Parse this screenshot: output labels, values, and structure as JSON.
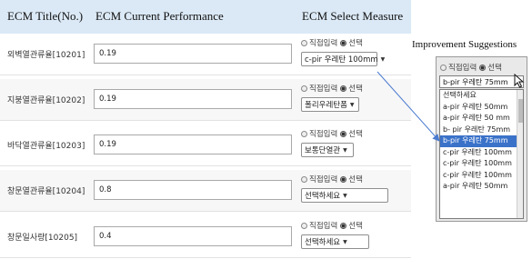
{
  "header": {
    "col_title": "ECM Title(No.)",
    "col_perf": "ECM Current Performance",
    "col_measure": "ECM Select Measure"
  },
  "radio": {
    "direct": "직접입력",
    "select": "선택"
  },
  "rows": [
    {
      "title": "외벽열관류율[10201]",
      "perf": "0.19",
      "measure": "c-pir 우레탄 100mm"
    },
    {
      "title": "지붕열관류율[10202]",
      "perf": "0.19",
      "measure": "폴리우레탄폼"
    },
    {
      "title": "바닥열관류율[10203]",
      "perf": "0.19",
      "measure": "보통단열관"
    },
    {
      "title": "창문열관류율[10204]",
      "perf": "0.8",
      "measure": "선택하세요"
    },
    {
      "title": "창문일사량[10205]",
      "perf": "0.4",
      "measure": "선택하세요"
    }
  ],
  "panel": {
    "title": "Improvement Suggestions",
    "selected": "b-pir 우레탄 75mm",
    "options": [
      "선택하세요",
      "a-pir 우레탄 50mm",
      "a-pir 우레탄 50 mm",
      "b- pir 우레탄 75mm",
      "b-pir 우레탄 75mm",
      "c-pir 우레탄 100mm",
      "c-pir 우레탄 100mm",
      "c-pir 우레탄 100mm",
      "a-pir 우레탄 50mm"
    ],
    "highlighted_index": 4
  },
  "colors": {
    "header_bg": "#dbe9f6",
    "highlight": "#3a72c9",
    "arrow": "#4a7bd0"
  }
}
